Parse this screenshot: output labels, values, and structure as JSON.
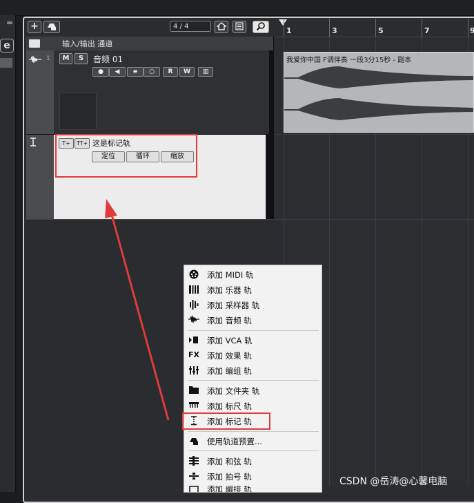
{
  "toolbar": {
    "add_track_label": "+",
    "counter": "4 / 4",
    "search_icon": "search-icon"
  },
  "tracks": {
    "io_header": "输入/输出 通道",
    "audio": {
      "number": "1",
      "name": "音频 01",
      "mute": "M",
      "solo": "S"
    },
    "marker": {
      "name": "这是标记轨",
      "add_marker": "T+",
      "add_cycle_marker": "TT+",
      "locate_label": "定位",
      "cycle_label": "循环",
      "zoom_label": "缩放"
    }
  },
  "ruler": {
    "bars": [
      "1",
      "3",
      "5",
      "7",
      "9"
    ]
  },
  "clip": {
    "title": "我爱你中国 F调伴奏 一段3分15秒 - 副本"
  },
  "context_menu": {
    "items": [
      {
        "label": "添加 MIDI 轨",
        "icon": "midi-icon"
      },
      {
        "label": "添加 乐器 轨",
        "icon": "instrument-icon"
      },
      {
        "label": "添加 采样器 轨",
        "icon": "sampler-icon"
      },
      {
        "label": "添加 音频 轨",
        "icon": "audio-icon"
      },
      {
        "label": "添加 VCA 轨",
        "icon": "vca-icon"
      },
      {
        "label": "添加 效果 轨",
        "icon": "fx-icon"
      },
      {
        "label": "添加 编组 轨",
        "icon": "group-icon"
      },
      {
        "label": "添加 文件夹 轨",
        "icon": "folder-icon"
      },
      {
        "label": "添加 标尺 轨",
        "icon": "ruler-icon"
      },
      {
        "label": "添加 标记 轨",
        "icon": "marker-icon"
      },
      {
        "label": "使用轨道预置...",
        "icon": "preset-icon"
      },
      {
        "label": "添加 和弦 轨",
        "icon": "chord-icon"
      },
      {
        "label": "添加 拍号 轨",
        "icon": "signature-icon"
      },
      {
        "label": "添加 编排 轨",
        "icon": "arranger-icon"
      }
    ],
    "fx_text": "FX"
  },
  "watermark": "CSDN @岳涛@心馨电脑",
  "colors": {
    "highlight_red": "#e03a3a",
    "menu_bg": "#f2f2f2",
    "marker_track_bg": "#ececec"
  }
}
